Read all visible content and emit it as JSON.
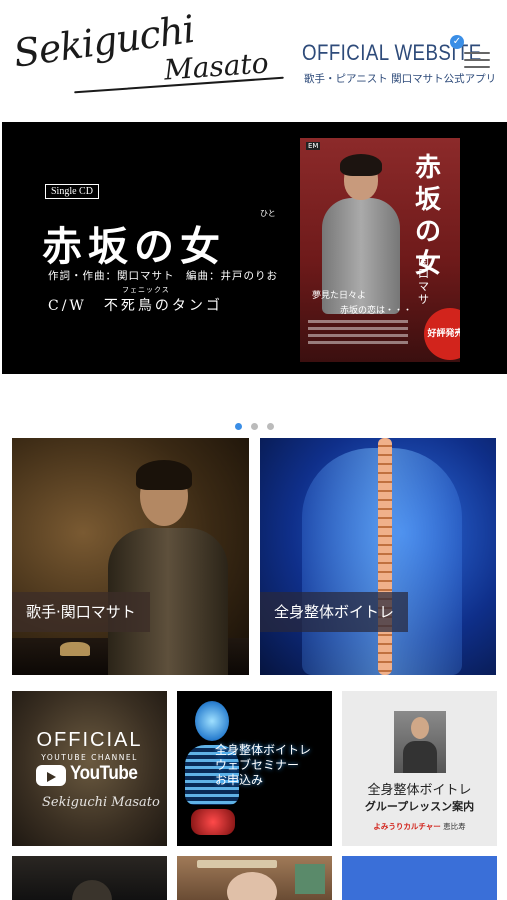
{
  "header": {
    "logo_first": "Sekiguchi",
    "logo_last": "Masato",
    "site_title": "OFFICIAL WEBSITE",
    "verified_glyph": "✓",
    "site_subtitle": "歌手・ピアニスト 関口マサト公式アプリ",
    "menu_icon": "hamburger-menu-icon"
  },
  "hero": {
    "badge": "Single CD",
    "title_ruby": "ひと",
    "title": "赤坂の女",
    "credits": "作詞・作曲：関口マサト　編曲：井戸のりお",
    "cw_ruby": "フェニックス",
    "cw": "C/W　不死鳥のタンゴ",
    "cover": {
      "label": "EM",
      "title": "赤坂の女",
      "artist": "関口マサ",
      "line1": "夢見た日々よ",
      "line2": "赤坂の恋は・・・",
      "sale": "好評発売中"
    }
  },
  "carousel": {
    "pages": 3,
    "active": 0
  },
  "tiles": {
    "singer_label": "歌手·関口マサト",
    "body_label": "全身整体ボイトレ"
  },
  "small_tiles": {
    "youtube": {
      "official": "OFFICIAL",
      "channel": "YOUTUBE CHANNEL",
      "brand": "YouTube",
      "signature": "Sekiguchi Masato"
    },
    "webinar": {
      "line1": "全身整体ボイトレ",
      "line2": "ウェブセミナー",
      "line3": "お申込み"
    },
    "lesson": {
      "line1": "全身整体ボイトレ",
      "line2": "グループレッスン案内",
      "line3_brand": "よみうりカルチャー",
      "line3_place": "恵比寿"
    }
  },
  "colors": {
    "accent": "#2e4b7a",
    "verified": "#3a8ee6",
    "sale": "#d2241c",
    "dot_active": "#3a8ee6",
    "dot_inactive": "#bbbbbb"
  }
}
